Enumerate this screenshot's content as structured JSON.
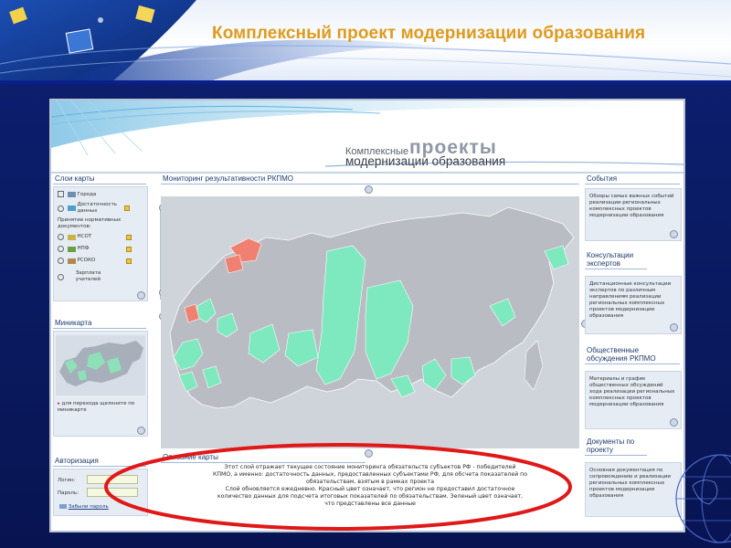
{
  "slide": {
    "title": "Комплексный проект модернизации образования"
  },
  "portal": {
    "logo": {
      "small": "Комплексные",
      "big": "проекты",
      "sub": "модернизации образования"
    },
    "left": {
      "layers": {
        "title": "Слои карты",
        "items": [
          "Города",
          "Достаточность данных"
        ],
        "docs_label": "Принятие нормативных документов:",
        "doc_items": [
          "НСОТ",
          "НПФ",
          "РСОКО",
          "Зарплата учителей"
        ]
      },
      "minimap": {
        "title": "Миникарта",
        "hint": "для перехода щелкните по миникарте"
      },
      "auth": {
        "title": "Авторизация",
        "login_label": "Логин:",
        "password_label": "Пароль:",
        "forgot": "Забыли пароль"
      }
    },
    "center": {
      "map_title": "Мониторинг результативности РКПМО",
      "desc_title": "Описание карты",
      "desc_lines": [
        "Этот слой отражает текущее состояние мониторинга обязательств субъектов РФ - победителей",
        "КПМО, а именно: достаточность данных, предоставленных субъектами РФ, для обсчета показателей по",
        "обязательствам, взятым в рамках проекта",
        "Слой обновляется ежедневно. Красный цвет означает, что регион не предоставил достаточное",
        "количество данных для подсчета итоговых показателей по обязательствам. Зеленый цвет означает,",
        "что представлены все данные"
      ]
    },
    "right": {
      "sections": [
        {
          "title": "События",
          "text": "Обзоры самых важных событий реализации региональных комплексных проектов модернизации образования"
        },
        {
          "title": "Консультации экспертов",
          "text": "Дистанционные консультации экспертов по различным направлениям реализации региональных комплексных проектов модернизации образования"
        },
        {
          "title": "Общественные обсуждения РКПМО",
          "text": "Материалы и график общественных обсуждений хода реализации региональных комплексных проектов модернизации образования"
        },
        {
          "title": "Документы по проекту",
          "text": "Основная документация по сопровождению и реализации региональных комплексных проектов модернизации образования"
        }
      ]
    }
  },
  "colors": {
    "title": "#e09a1c",
    "green_region": "#7ee8be",
    "red_region": "#f08072",
    "grey_region": "#b9bcc2",
    "oval": "#e01818"
  }
}
